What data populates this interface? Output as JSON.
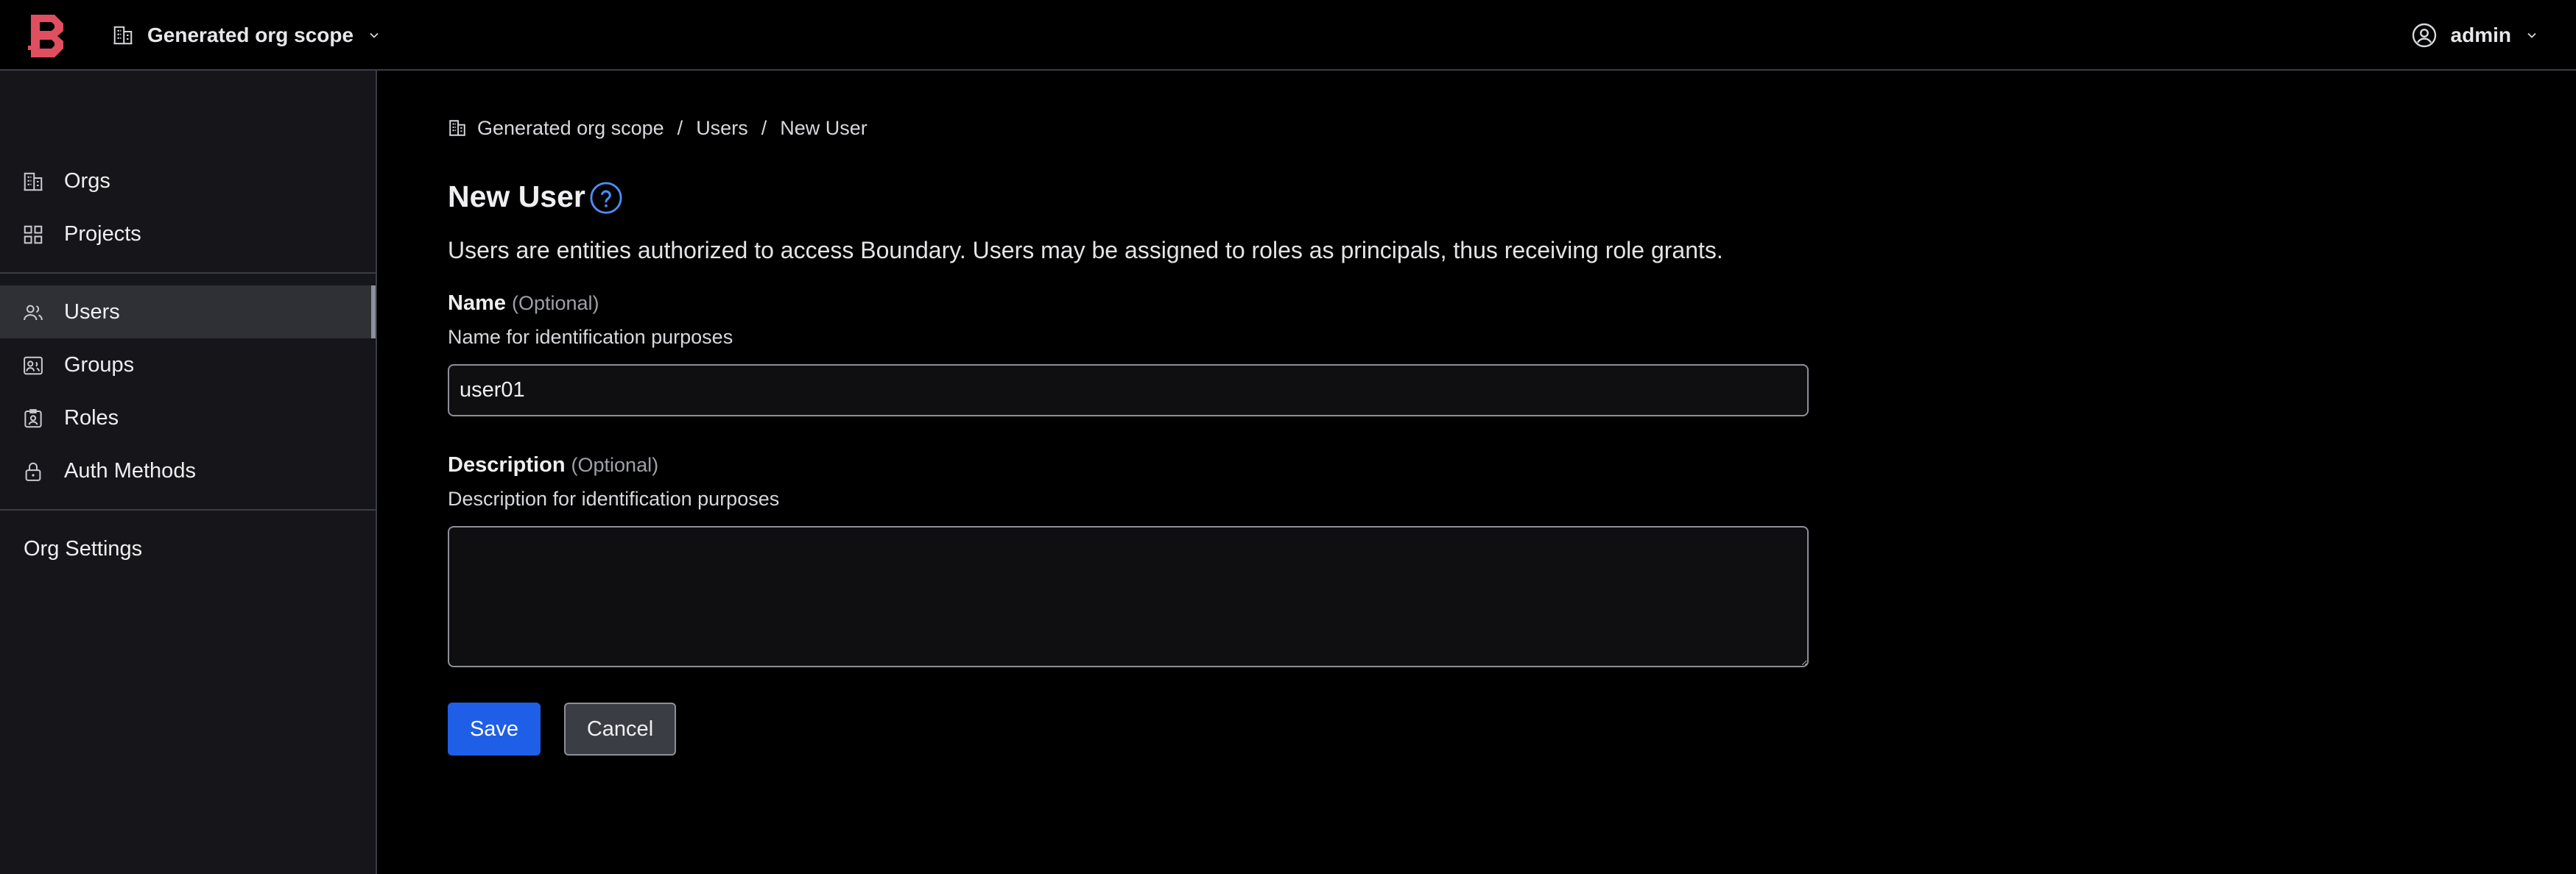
{
  "header": {
    "scope_label": "Generated org scope",
    "user_label": "admin"
  },
  "sidebar": {
    "items": [
      {
        "label": "Orgs",
        "icon": "building-icon"
      },
      {
        "label": "Projects",
        "icon": "grid-icon"
      },
      {
        "label": "Users",
        "icon": "users-icon",
        "active": true
      },
      {
        "label": "Groups",
        "icon": "groups-icon"
      },
      {
        "label": "Roles",
        "icon": "id-badge-icon"
      },
      {
        "label": "Auth Methods",
        "icon": "lock-icon"
      }
    ],
    "settings_label": "Org Settings"
  },
  "breadcrumb": {
    "scope": "Generated org scope",
    "section": "Users",
    "current": "New User"
  },
  "page": {
    "title": "New User",
    "description": "Users are entities authorized to access Boundary. Users may be assigned to roles as principals, thus receiving role grants."
  },
  "form": {
    "name_label": "Name",
    "name_optional": "(Optional)",
    "name_help": "Name for identification purposes",
    "name_value": "user01",
    "description_label": "Description",
    "description_optional": "(Optional)",
    "description_help": "Description for identification purposes",
    "description_value": ""
  },
  "actions": {
    "save_label": "Save",
    "cancel_label": "Cancel"
  },
  "colors": {
    "accent": "#1f5ee6",
    "brand": "#e04f5f",
    "background": "#000000",
    "sidebar": "#16161a"
  }
}
